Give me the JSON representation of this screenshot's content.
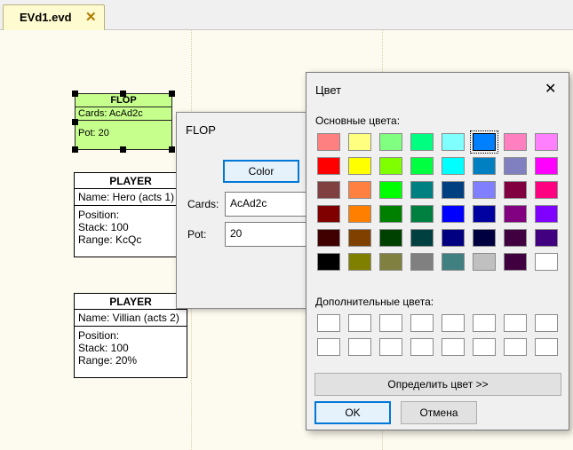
{
  "tab": {
    "label": "EVd1.evd",
    "close": "✕"
  },
  "flop_node": {
    "title": "FLOP",
    "cards": "Cards: AcAd2c",
    "pot": "Pot: 20",
    "fill": "#c6ff8c"
  },
  "players": [
    {
      "title": "PLAYER",
      "name": "Name: Hero (acts 1)",
      "position": "Position:",
      "stack": "Stack: 100",
      "range": "Range: KcQc"
    },
    {
      "title": "PLAYER",
      "name": "Name: Villian (acts 2)",
      "position": "Position:",
      "stack": "Stack: 100",
      "range": "Range: 20%"
    }
  ],
  "flop_dialog": {
    "title": "FLOP",
    "color_button": "Color",
    "cards_label": "Cards:",
    "cards_value": "AcAd2c",
    "pot_label": "Pot:",
    "pot_value": "20"
  },
  "color_dialog": {
    "title": "Цвет",
    "close": "✕",
    "basic_label": "Основные цвета:",
    "custom_label": "Дополнительные цвета:",
    "define_button": "Определить цвет >>",
    "ok_button": "OK",
    "cancel_button": "Отмена",
    "selected_index": 5,
    "basic_colors": [
      "#ff8080",
      "#ffff80",
      "#80ff80",
      "#00ff80",
      "#80ffff",
      "#0080ff",
      "#ff80c0",
      "#ff80ff",
      "#ff0000",
      "#ffff00",
      "#80ff00",
      "#00ff40",
      "#00ffff",
      "#0080c0",
      "#8080c0",
      "#ff00ff",
      "#804040",
      "#ff8040",
      "#00ff00",
      "#008080",
      "#004080",
      "#8080ff",
      "#800040",
      "#ff0080",
      "#800000",
      "#ff8000",
      "#008000",
      "#008040",
      "#0000ff",
      "#0000a0",
      "#800080",
      "#8000ff",
      "#400000",
      "#804000",
      "#004000",
      "#004040",
      "#000080",
      "#000040",
      "#400040",
      "#400080",
      "#000000",
      "#808000",
      "#808040",
      "#808080",
      "#408080",
      "#c0c0c0",
      "#400040",
      "#ffffff"
    ]
  }
}
